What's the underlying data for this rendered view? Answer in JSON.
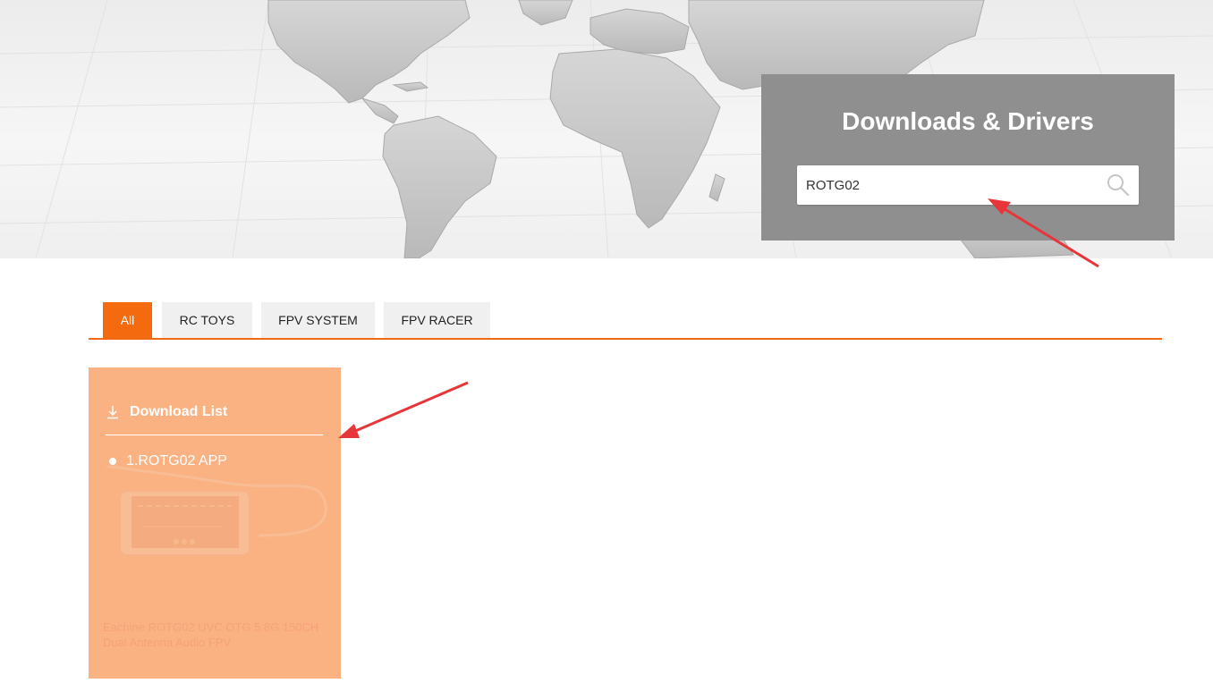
{
  "hero": {
    "title": "Downloads & Drivers",
    "search": {
      "value": "ROTG02",
      "icon": "search-icon"
    }
  },
  "tabs": [
    {
      "label": "All",
      "active": true
    },
    {
      "label": "RC TOYS",
      "active": false
    },
    {
      "label": "FPV SYSTEM",
      "active": false
    },
    {
      "label": "FPV RACER",
      "active": false
    }
  ],
  "card": {
    "download_header": "Download List",
    "download_icon": "download-icon",
    "items": [
      {
        "label": "1.ROTG02 APP"
      }
    ],
    "caption": "Eachine ROTG02 UVC OTG 5.8G 150CH Dual Antenna Audio FPV"
  },
  "colors": {
    "accent": "#f46a0e",
    "card_bg": "#fbb282",
    "panel_bg": "#8f8f8f",
    "arrow": "#e8353a"
  }
}
